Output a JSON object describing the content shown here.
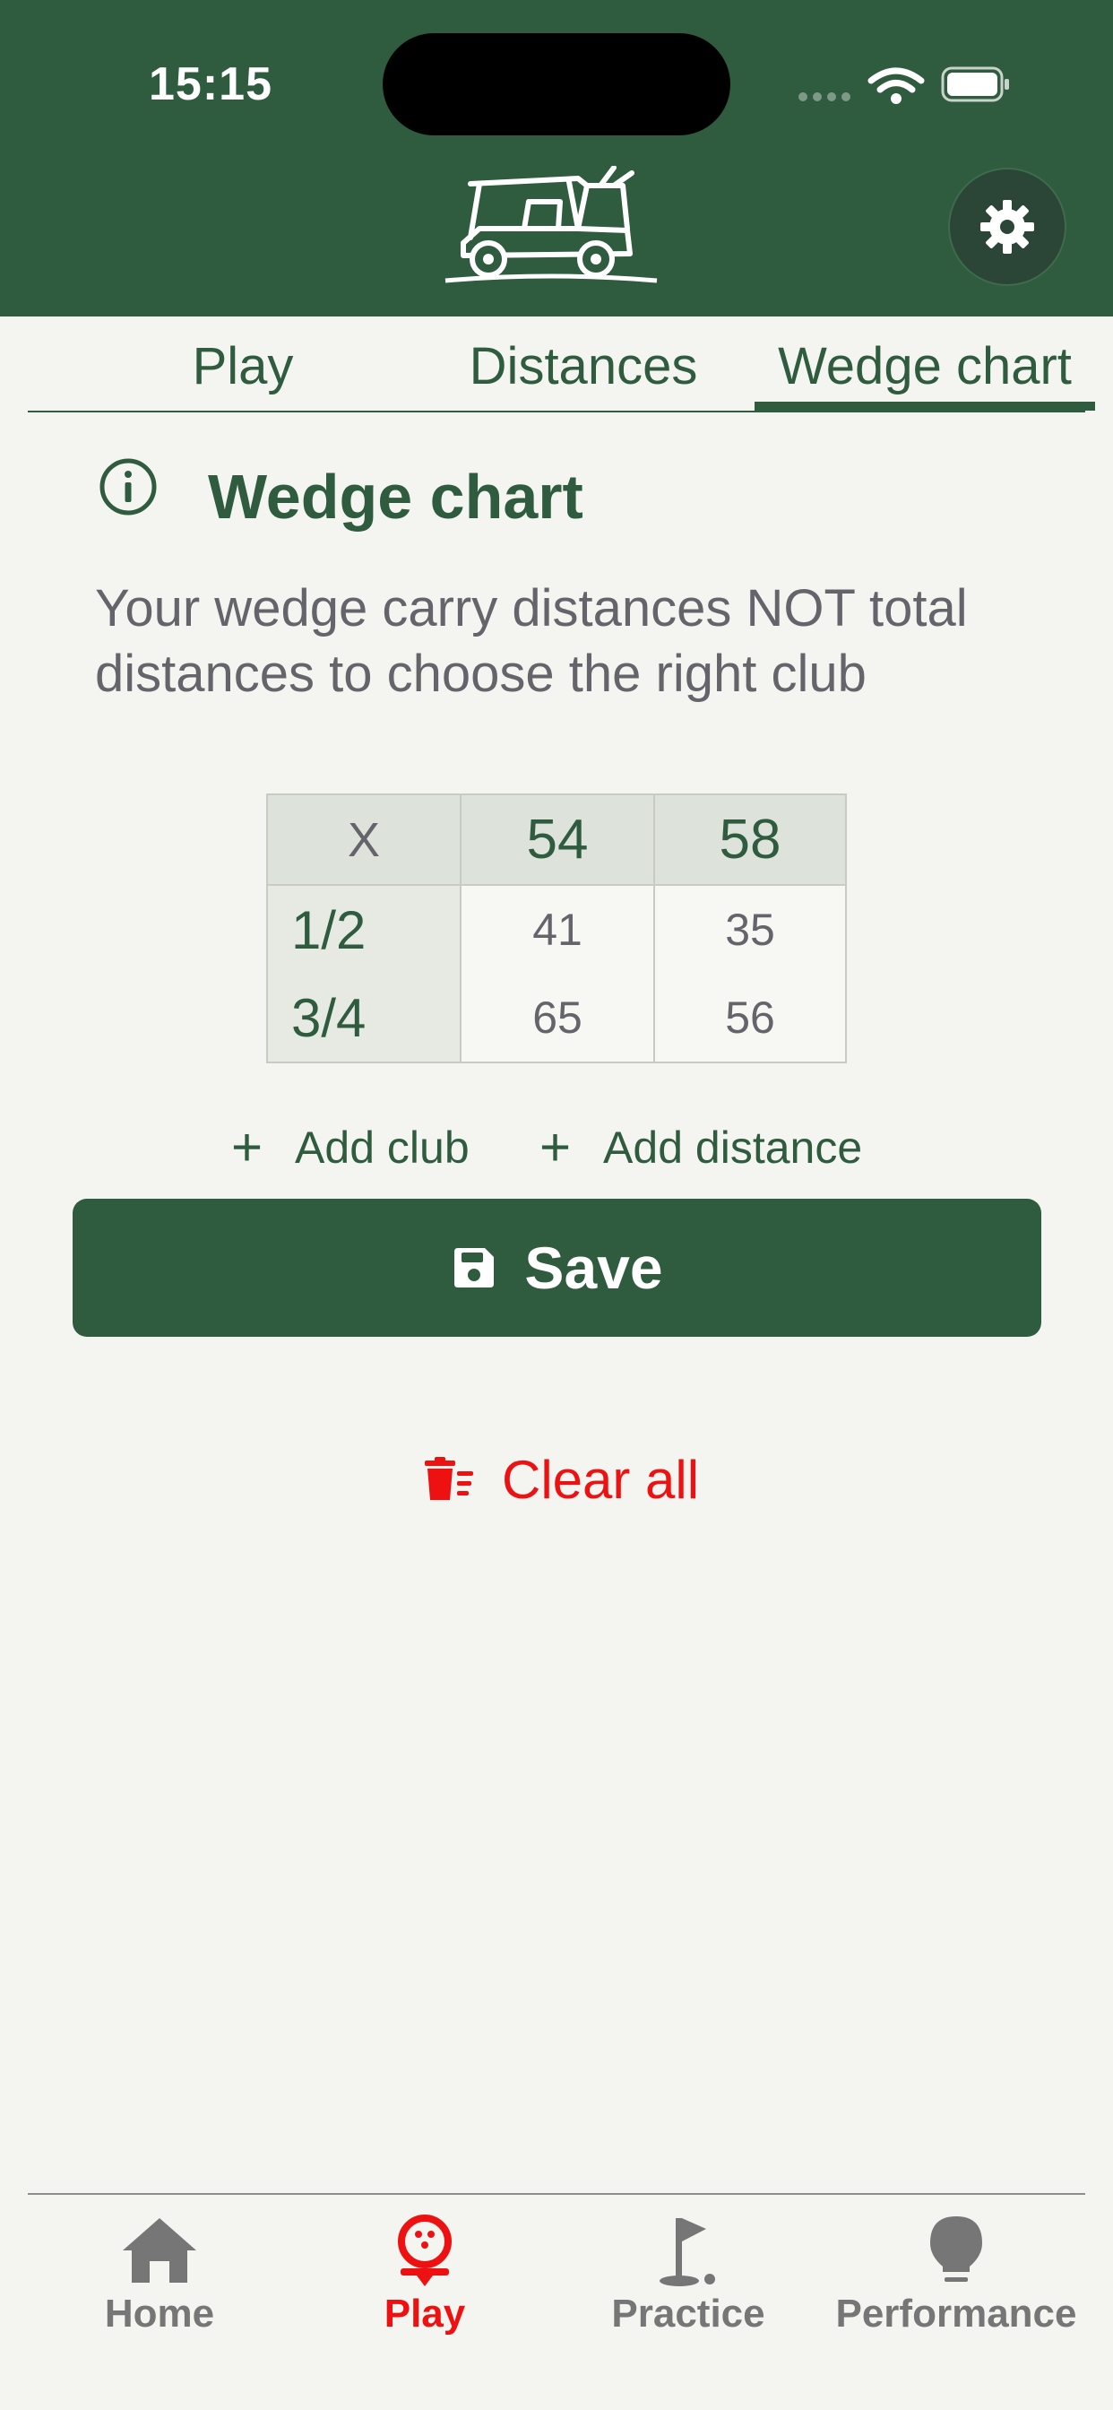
{
  "status_bar": {
    "time": "15:15"
  },
  "tabs": [
    {
      "label": "Play",
      "active": false
    },
    {
      "label": "Distances",
      "active": false
    },
    {
      "label": "Wedge chart",
      "active": true
    }
  ],
  "page": {
    "title": "Wedge chart",
    "description": "Your wedge carry distances NOT total distances to choose the right club"
  },
  "wedge_table": {
    "corner": "X",
    "clubs": [
      "54",
      "58"
    ],
    "rows": [
      {
        "swing": "1/2",
        "values": [
          "41",
          "35"
        ]
      },
      {
        "swing": "3/4",
        "values": [
          "65",
          "56"
        ]
      }
    ]
  },
  "actions": {
    "add_club": "Add club",
    "add_distance": "Add distance",
    "save": "Save",
    "clear_all": "Clear all"
  },
  "bottom_nav": [
    {
      "label": "Home",
      "icon": "home-icon",
      "active": false
    },
    {
      "label": "Play",
      "icon": "golf-ball-tee-icon",
      "active": true
    },
    {
      "label": "Practice",
      "icon": "flag-icon",
      "active": false
    },
    {
      "label": "Performance",
      "icon": "lightbulb-icon",
      "active": false
    }
  ],
  "colors": {
    "brand_green": "#2f5b3e",
    "background": "#f4f4f0",
    "danger_red": "#ee1111",
    "inactive_gray": "#767676"
  }
}
